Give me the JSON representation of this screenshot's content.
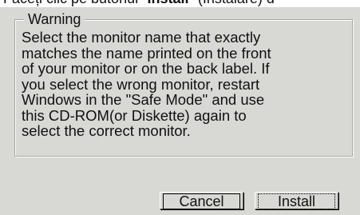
{
  "top_strip": {
    "text_prefix": "Faceți clic pe butonul \"",
    "bold_text": "Install",
    "text_suffix": "\" (Instalare) d"
  },
  "dialog": {
    "group_title": "Warning",
    "message": "Select the monitor name that exactly\nmatches the name printed on the front\nof your monitor or on the back label. If\nyou select the wrong monitor, restart\nWindows in the \"Safe Mode\" and use\nthis CD-ROM(or Diskette) again to\nselect the correct monitor.",
    "buttons": {
      "cancel_label": "Cancel",
      "install_label": "Install"
    }
  }
}
